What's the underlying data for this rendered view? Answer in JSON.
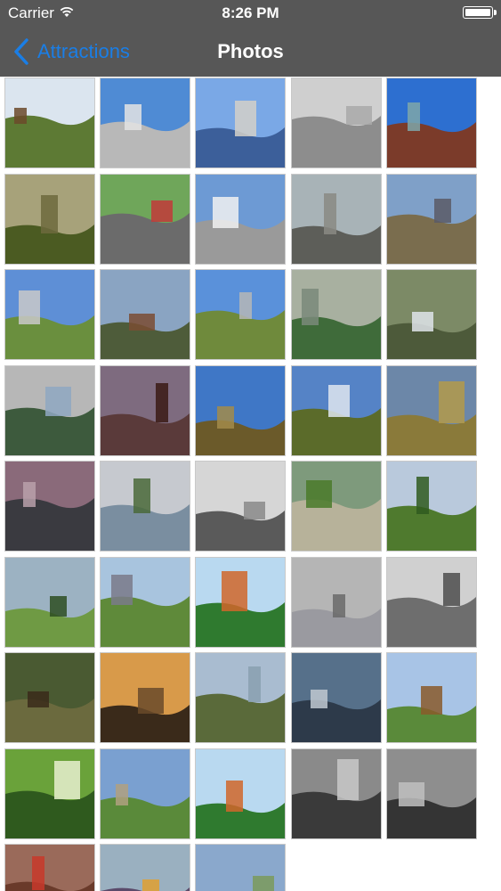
{
  "status_bar": {
    "carrier": "Carrier",
    "time": "8:26 PM"
  },
  "nav": {
    "back_label": "Attractions",
    "title": "Photos"
  },
  "thumbnails": [
    {
      "icon": "park-fence-photo",
      "sky": "#dbe5ef",
      "ground": "#5d7a34",
      "accent": "#6b4a2a"
    },
    {
      "icon": "calgary-tower-photo",
      "sky": "#4f8bd4",
      "ground": "#b8b8b8",
      "accent": "#e3e3e3"
    },
    {
      "icon": "calgary-tower-up-photo",
      "sky": "#7aa8e6",
      "ground": "#3c5f9a",
      "accent": "#d4d0c8"
    },
    {
      "icon": "tower-grayscale-photo",
      "sky": "#cfcfcf",
      "ground": "#8d8d8d",
      "accent": "#a9a9a9"
    },
    {
      "icon": "glass-building-photo",
      "sky": "#2d6fd0",
      "ground": "#7b3b2a",
      "accent": "#7fa7a9"
    },
    {
      "icon": "forest-photo",
      "sky": "#a7a27a",
      "ground": "#4b5b22",
      "accent": "#6d6a3d"
    },
    {
      "icon": "amusement-ride-photo",
      "sky": "#6fa65a",
      "ground": "#6b6b6b",
      "accent": "#c23a3a"
    },
    {
      "icon": "clouds-lake-photo",
      "sky": "#6d9ad4",
      "ground": "#9a9a9a",
      "accent": "#f1f1f1"
    },
    {
      "icon": "fort-calgary-sign-photo",
      "sky": "#a8b3b7",
      "ground": "#5d5e59",
      "accent": "#8a8a84"
    },
    {
      "icon": "heritage-house-photo",
      "sky": "#7fa0c8",
      "ground": "#7a6d4e",
      "accent": "#5a5a66"
    },
    {
      "icon": "fountain-skyline-photo",
      "sky": "#5e8fd6",
      "ground": "#6a8f3e",
      "accent": "#c9c9c9"
    },
    {
      "icon": "brown-building-photo",
      "sky": "#8aa4c2",
      "ground": "#4e5c3a",
      "accent": "#7a4c32"
    },
    {
      "icon": "fountain-skyline-2-photo",
      "sky": "#5a91da",
      "ground": "#6f8a3c",
      "accent": "#b6b6b6"
    },
    {
      "icon": "garden-pond-photo",
      "sky": "#a8b0a0",
      "ground": "#3f6b3a",
      "accent": "#7a8a7a"
    },
    {
      "icon": "sculpture-garden-photo",
      "sky": "#7c8a66",
      "ground": "#4d5a3a",
      "accent": "#dfe4ea"
    },
    {
      "icon": "greenhouse-fountain-photo",
      "sky": "#b7b7b7",
      "ground": "#3d5a3d",
      "accent": "#8fa8c2"
    },
    {
      "icon": "red-tower-sculpture-photo",
      "sky": "#7e6b7f",
      "ground": "#5a3a3a",
      "accent": "#3a1a14"
    },
    {
      "icon": "river-valley-photo",
      "sky": "#3f77c6",
      "ground": "#6b5a2a",
      "accent": "#a28b4a"
    },
    {
      "icon": "trees-clouds-photo",
      "sky": "#5583c6",
      "ground": "#5b6b2a",
      "accent": "#dfe6ee"
    },
    {
      "icon": "path-meadow-photo",
      "sky": "#6c87a8",
      "ground": "#8a7a3a",
      "accent": "#b39a4a"
    },
    {
      "icon": "dusk-clouds-photo",
      "sky": "#8a6a7a",
      "ground": "#3a3a40",
      "accent": "#b8a0aa"
    },
    {
      "icon": "lake-view-photo",
      "sky": "#c6c9cf",
      "ground": "#7a8ea0",
      "accent": "#4a6a3a"
    },
    {
      "icon": "bw-trail-photo",
      "sky": "#d6d6d6",
      "ground": "#5a5a5a",
      "accent": "#8a8a8a"
    },
    {
      "icon": "shore-photo",
      "sky": "#7e9a7c",
      "ground": "#b7b29a",
      "accent": "#4a7a2a"
    },
    {
      "icon": "grass-field-photo",
      "sky": "#b9c9dc",
      "ground": "#4f7a2e",
      "accent": "#2f5a1e"
    },
    {
      "icon": "park-trees-photo",
      "sky": "#9cb2c2",
      "ground": "#6f9a44",
      "accent": "#2e4e22"
    },
    {
      "icon": "grandstand-photo",
      "sky": "#a8c4de",
      "ground": "#5f8a3a",
      "accent": "#7a7a8a"
    },
    {
      "icon": "church-spire-photo",
      "sky": "#b9d9f0",
      "ground": "#2f7a2f",
      "accent": "#d0662a"
    },
    {
      "icon": "city-street-photo",
      "sky": "#b5b5b5",
      "ground": "#9a9aa0",
      "accent": "#6a6a6a"
    },
    {
      "icon": "bw-buildings-photo",
      "sky": "#d0d0d0",
      "ground": "#6e6e6e",
      "accent": "#4e4e4e"
    },
    {
      "icon": "squirrel-photo",
      "sky": "#4a5a32",
      "ground": "#6b6a3e",
      "accent": "#3a2a1a"
    },
    {
      "icon": "sunset-river-photo",
      "sky": "#d89a4a",
      "ground": "#3a2a1a",
      "accent": "#6a4a2a"
    },
    {
      "icon": "river-bank-photo",
      "sky": "#a9bcd0",
      "ground": "#5a6a3a",
      "accent": "#8aa0b0"
    },
    {
      "icon": "canopy-walkway-photo",
      "sky": "#56708a",
      "ground": "#2d3a4a",
      "accent": "#c0c8d0"
    },
    {
      "icon": "park-bench-photo",
      "sky": "#a8c4e6",
      "ground": "#5a8a3a",
      "accent": "#8a5a2a"
    },
    {
      "icon": "dandelion-closeup-photo",
      "sky": "#6aa23a",
      "ground": "#2f5a1e",
      "accent": "#e8f0d0"
    },
    {
      "icon": "park-path-photo",
      "sky": "#7aa0d0",
      "ground": "#5a8a3a",
      "accent": "#b0a080"
    },
    {
      "icon": "church-spire-2-photo",
      "sky": "#b9d9f0",
      "ground": "#2f7a2f",
      "accent": "#d0662a"
    },
    {
      "icon": "bw-street-rain-photo",
      "sky": "#8a8a8a",
      "ground": "#3a3a3a",
      "accent": "#c8c8c8"
    },
    {
      "icon": "bw-street-rain-2-photo",
      "sky": "#8e8e8e",
      "ground": "#343434",
      "accent": "#bfbfbf"
    },
    {
      "icon": "red-banners-photo",
      "sky": "#9a6a5a",
      "ground": "#6a3a2a",
      "accent": "#c8382a"
    },
    {
      "icon": "balloons-photo",
      "sky": "#9ab0c0",
      "ground": "#5a4a6a",
      "accent": "#e0a030"
    },
    {
      "icon": "city-park-photo",
      "sky": "#8aa8cc",
      "ground": "#3f6a2a",
      "accent": "#7a9a5a"
    }
  ]
}
